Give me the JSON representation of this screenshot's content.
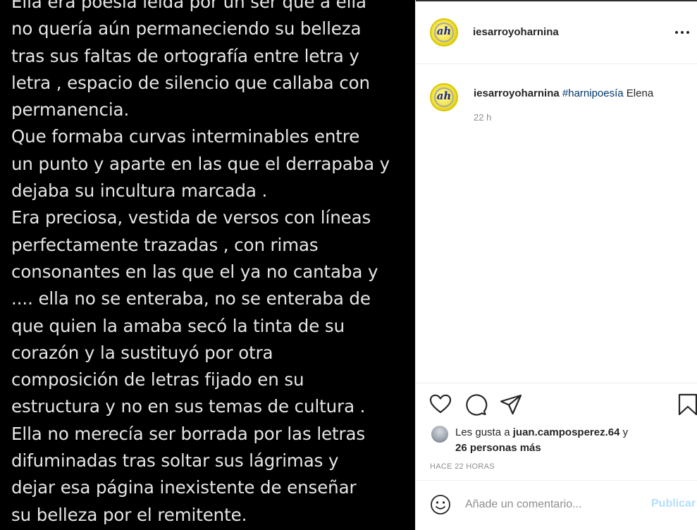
{
  "post": {
    "poem_lines": [
      "Ella era poesía leída por un ser que a ella",
      "no  quería  aún permaneciendo su belleza",
      "tras sus faltas de ortografía entre letra y",
      "letra , espacio de silencio que callaba con",
      "permanencia.",
      "Que formaba curvas interminables entre",
      "un punto y aparte en las que el derrapaba y",
      "dejaba su incultura marcada .",
      "Era preciosa, vestida de versos con líneas",
      "perfectamente trazadas , con rimas",
      "consonantes en las que el ya no cantaba y",
      ".... ella no se enteraba, no se enteraba de",
      "que quien la amaba secó la tinta de su",
      "corazón y la sustituyó por otra",
      "composición de letras fijado en su",
      "estructura y no en sus temas de cultura .",
      "Ella no merecía ser borrada por las letras",
      "difuminadas tras soltar sus lágrimas y",
      "dejar esa página  inexistente de enseñar",
      "su belleza por el remitente."
    ]
  },
  "header": {
    "username": "iesarroyoharnina",
    "avatar_monogram": "ah",
    "more_icon": "more-horizontal-icon"
  },
  "caption": {
    "username": "iesarroyoharnina",
    "hashtag": "#harnipoesía",
    "text": "Elena",
    "time": "22 h"
  },
  "actions": {
    "icons": [
      "heart-icon",
      "comment-icon",
      "share-icon",
      "bookmark-icon"
    ],
    "likes_prefix": "Les gusta a ",
    "liked_by": "juan.camposperez.64",
    "likes_joiner": " y",
    "others": "26 personas más",
    "timestamp": "HACE 22 HORAS"
  },
  "comment": {
    "placeholder": "Añade un comentario...",
    "submit_label": "Publicar",
    "emoji_icon": "emoji-icon"
  },
  "colors": {
    "image_bg": "#000000",
    "poem_text": "#e6e6e6",
    "hashtag": "#00376b",
    "publish_disabled": "#b2dffc",
    "muted": "#8e8e8e"
  }
}
